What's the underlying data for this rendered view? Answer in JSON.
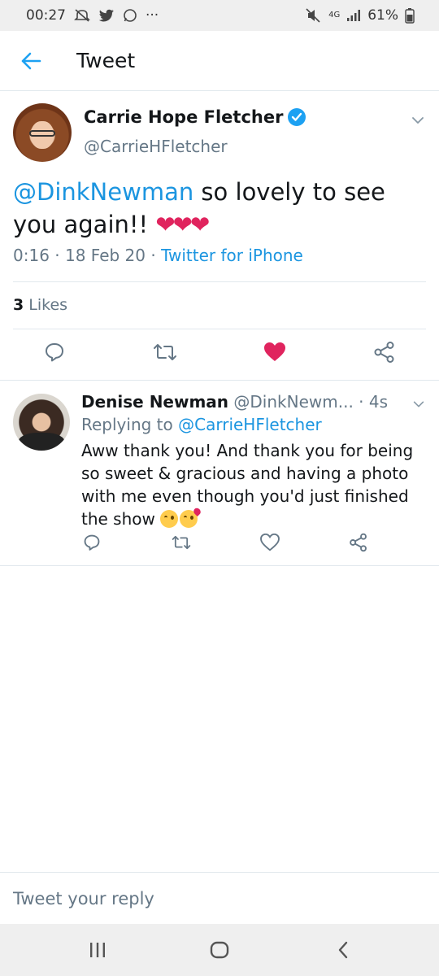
{
  "status_bar": {
    "time": "00:27",
    "network": "4G",
    "battery": "61%",
    "more": "···"
  },
  "header": {
    "title": "Tweet"
  },
  "main_tweet": {
    "author_name": "Carrie Hope Fletcher",
    "author_handle": "@CarrieHFletcher",
    "mention": "@DinkNewman",
    "text": " so lovely to see you again!! ",
    "hearts": "❤❤❤",
    "time": "0:16 · 18 Feb 20 · ",
    "source": "Twitter for iPhone",
    "likes_count": "3",
    "likes_label": " Likes",
    "liked": true
  },
  "reply_tweet": {
    "author_name": "Denise Newman",
    "author_handle": "@DinkNewm...",
    "age": " · 4s",
    "replying_prefix": "Replying to ",
    "replying_to": "@CarrieHFletcher",
    "text": "Aww thank you! And thank you for being so sweet & gracious and having a photo with me even though you'd just finished the show "
  },
  "composer": {
    "placeholder": "Tweet your reply"
  },
  "colors": {
    "accent": "#1da1f2",
    "link": "#1b95e0",
    "like": "#e0245e",
    "muted": "#657786"
  },
  "icons": [
    "back-arrow-icon",
    "verified-icon",
    "chevron-down-icon",
    "reply-icon",
    "retweet-icon",
    "heart-icon",
    "share-icon",
    "recents-icon",
    "home-icon",
    "back-nav-icon"
  ]
}
